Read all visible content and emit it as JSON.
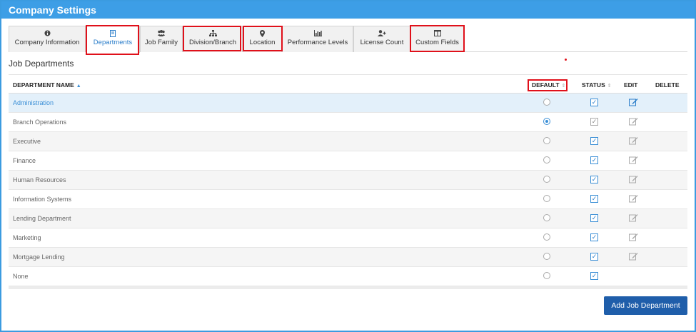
{
  "window": {
    "title": "Company Settings"
  },
  "tabs": [
    {
      "label": "Company Information",
      "icon": "info-circle-icon",
      "glyph": "i"
    },
    {
      "label": "Departments",
      "icon": "bookmark-icon",
      "glyph": "▯",
      "active": true
    },
    {
      "label": "Job Family",
      "icon": "users-icon",
      "glyph": "👥"
    },
    {
      "label": "Division/Branch",
      "icon": "sitemap-icon",
      "glyph": "⋮"
    },
    {
      "label": "Location",
      "icon": "map-marker-icon",
      "glyph": "⚲"
    },
    {
      "label": "Performance Levels",
      "icon": "bar-chart-icon",
      "glyph": "▥"
    },
    {
      "label": "License Count",
      "icon": "user-plus-icon",
      "glyph": "👤"
    },
    {
      "label": "Custom Fields",
      "icon": "columns-icon",
      "glyph": "◫"
    }
  ],
  "section": {
    "title": "Job Departments"
  },
  "table": {
    "headers": {
      "name": "DEPARTMENT NAME",
      "default": "DEFAULT",
      "status": "STATUS",
      "edit": "EDIT",
      "delete": "DELETE"
    },
    "rows": [
      {
        "name": "Administration",
        "default": false,
        "status": true,
        "editable": true,
        "selected": true
      },
      {
        "name": "Branch Operations",
        "default": true,
        "status": true,
        "editable": true,
        "status_grey": true
      },
      {
        "name": "Executive",
        "default": false,
        "status": true,
        "editable": true
      },
      {
        "name": "Finance",
        "default": false,
        "status": true,
        "editable": true
      },
      {
        "name": "Human Resources",
        "default": false,
        "status": true,
        "editable": true
      },
      {
        "name": "Information Systems",
        "default": false,
        "status": true,
        "editable": true
      },
      {
        "name": "Lending Department",
        "default": false,
        "status": true,
        "editable": true
      },
      {
        "name": "Marketing",
        "default": false,
        "status": true,
        "editable": true
      },
      {
        "name": "Mortgage Lending",
        "default": false,
        "status": true,
        "editable": true
      },
      {
        "name": "None",
        "default": false,
        "status": true,
        "editable": false
      }
    ]
  },
  "actions": {
    "add_label": "Add Job Department"
  },
  "colors": {
    "header": "#3d9ee6",
    "accent": "#2a7dc9",
    "button": "#1f5eaa",
    "highlight": "#e0101a"
  }
}
